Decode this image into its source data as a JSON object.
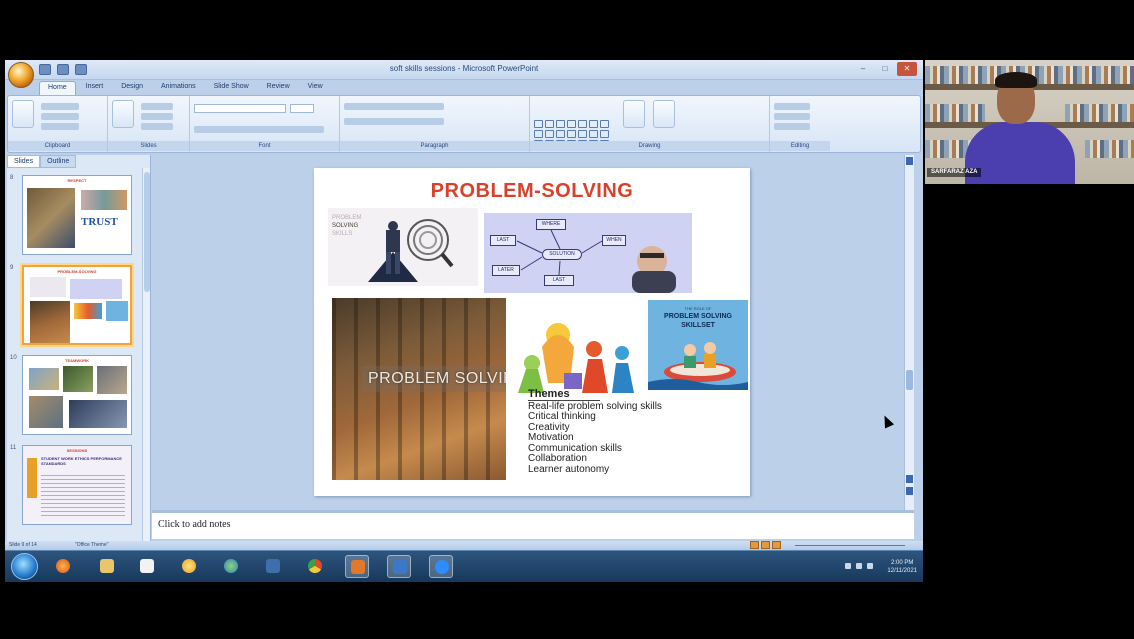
{
  "window": {
    "title": "soft skills sessions - Microsoft PowerPoint",
    "minimize": "–",
    "maximize": "□",
    "close": "✕"
  },
  "ribbon": {
    "tabs": [
      "Home",
      "Insert",
      "Design",
      "Animations",
      "Slide Show",
      "Review",
      "View"
    ],
    "active_tab": "Home",
    "groups": [
      "Clipboard",
      "Slides",
      "Font",
      "Paragraph",
      "Drawing",
      "Editing"
    ]
  },
  "left_pane": {
    "tabs": [
      "Slides",
      "Outline"
    ],
    "thumbnails": [
      {
        "number": "8",
        "title": "RESPECT",
        "label": "TRUST"
      },
      {
        "number": "9",
        "title": "PROBLEM-SOLVING"
      },
      {
        "number": "10",
        "title": "TEAMWORK"
      },
      {
        "number": "11",
        "title": "SESSIONS",
        "subtitle": "STUDENT WORK ETHICS PERFORMANCE STANDARDS"
      }
    ]
  },
  "slide": {
    "title": "PROBLEM-SOLVING",
    "skills_image": {
      "line1": "PROBLEM",
      "line2": "SOLVING",
      "line3": "SKILLS"
    },
    "flow_image": {
      "center": "SOLUTION",
      "top": "WHERE",
      "left1": "LAST",
      "left2": "LATER",
      "right1": "WHEN",
      "bottom": "LAST"
    },
    "autumn_image_caption": "PROBLEM SOLVING",
    "skillset_image": {
      "small": "THE ROLE OF",
      "big": "PROBLEM SOLVING SKILLSET"
    },
    "themes": {
      "heading": "Themes",
      "items": [
        "Real-life problem solving skills",
        "Critical thinking",
        "Creativity",
        "Motivation",
        "Communication skills",
        "Collaboration",
        "Learner autonomy"
      ]
    }
  },
  "notes": {
    "placeholder": "Click to add notes"
  },
  "statusbar": {
    "slide": "Slide 9 of 14",
    "theme": "\"Office Theme\""
  },
  "taskbar": {
    "time": "2:00 PM",
    "date": "12/11/2021"
  },
  "webcam": {
    "name": "SARFARAZ AZA"
  },
  "colors": {
    "title_red": "#d8412b",
    "ribbon_blue": "#d7e5f6",
    "selection_orange": "#f2a33c"
  }
}
